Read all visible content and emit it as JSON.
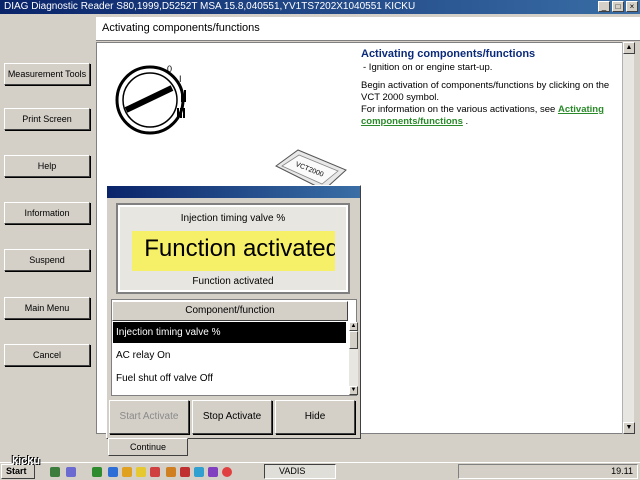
{
  "window": {
    "title": "DIAG Diagnostic Reader S80,1999,D5252T MSA 15.8,040551,YV1TS7202X1040551 KICKU"
  },
  "sidebar": {
    "items": [
      {
        "label": "Measurement Tools"
      },
      {
        "label": "Print Screen"
      },
      {
        "label": "Help"
      },
      {
        "label": "Information"
      },
      {
        "label": "Suspend"
      },
      {
        "label": "Main Menu"
      },
      {
        "label": "Cancel"
      }
    ]
  },
  "header": {
    "title": "Activating components/functions"
  },
  "info": {
    "title": "Activating components/functions",
    "bullet": "-  Ignition on or engine start-up.",
    "para1": "Begin activation of components/functions by clicking on the VCT 2000 symbol.",
    "para2_prefix": "For information on the various activations, see ",
    "link": "Activating components/functions",
    "para2_suffix": " ."
  },
  "illustration": {
    "vct_label": "VCT2000"
  },
  "dialog": {
    "component_name": "Injection timing valve %",
    "big_status": "Function activated",
    "status": "Function activated",
    "list_header": "Component/function",
    "items": [
      {
        "label": "Injection timing valve %",
        "selected": true
      },
      {
        "label": "AC relay On",
        "selected": false
      },
      {
        "label": "Fuel shut off valve Off",
        "selected": false
      }
    ],
    "buttons": {
      "start": "Start Activate",
      "stop": "Stop Activate",
      "hide": "Hide"
    }
  },
  "continue_label": "Continue",
  "taskbar": {
    "start_label": "Start",
    "task_label": "VADIS",
    "clock": "19.11",
    "overlay_text": "kicku"
  }
}
